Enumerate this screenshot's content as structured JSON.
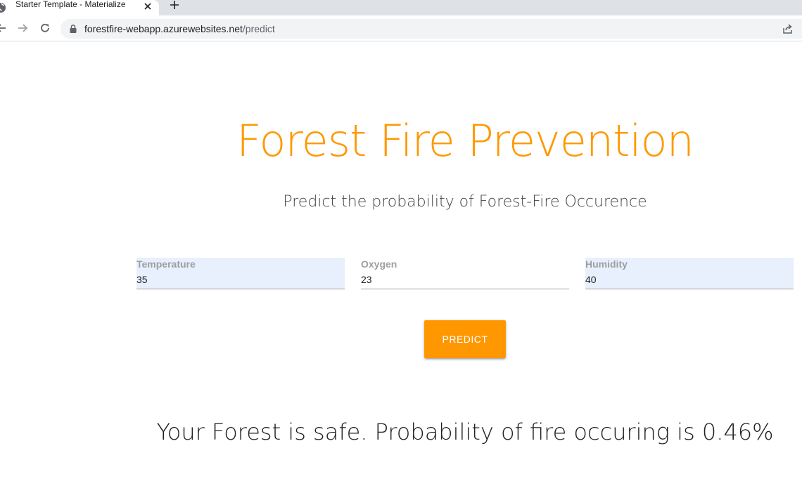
{
  "browser": {
    "tab_title": "Starter Template - Materialize",
    "url_host": "forestfire-webapp.azurewebsites.net",
    "url_path": "/predict"
  },
  "page": {
    "title": "Forest Fire Prevention",
    "subtitle": "Predict the probability of Forest-Fire Occurence"
  },
  "form": {
    "fields": [
      {
        "label": "Temperature",
        "value": "35",
        "autofilled": true
      },
      {
        "label": "Oxygen",
        "value": "23",
        "autofilled": false
      },
      {
        "label": "Humidity",
        "value": "40",
        "autofilled": true
      }
    ],
    "submit_label": "PREDICT"
  },
  "result": {
    "text": "Your Forest is safe. Probability of fire occuring is 0.46%"
  },
  "colors": {
    "accent": "#ff9800",
    "autofill_bg": "#e8f0fe",
    "label": "#9e9e9e",
    "tabstrip": "#dee1e6"
  }
}
